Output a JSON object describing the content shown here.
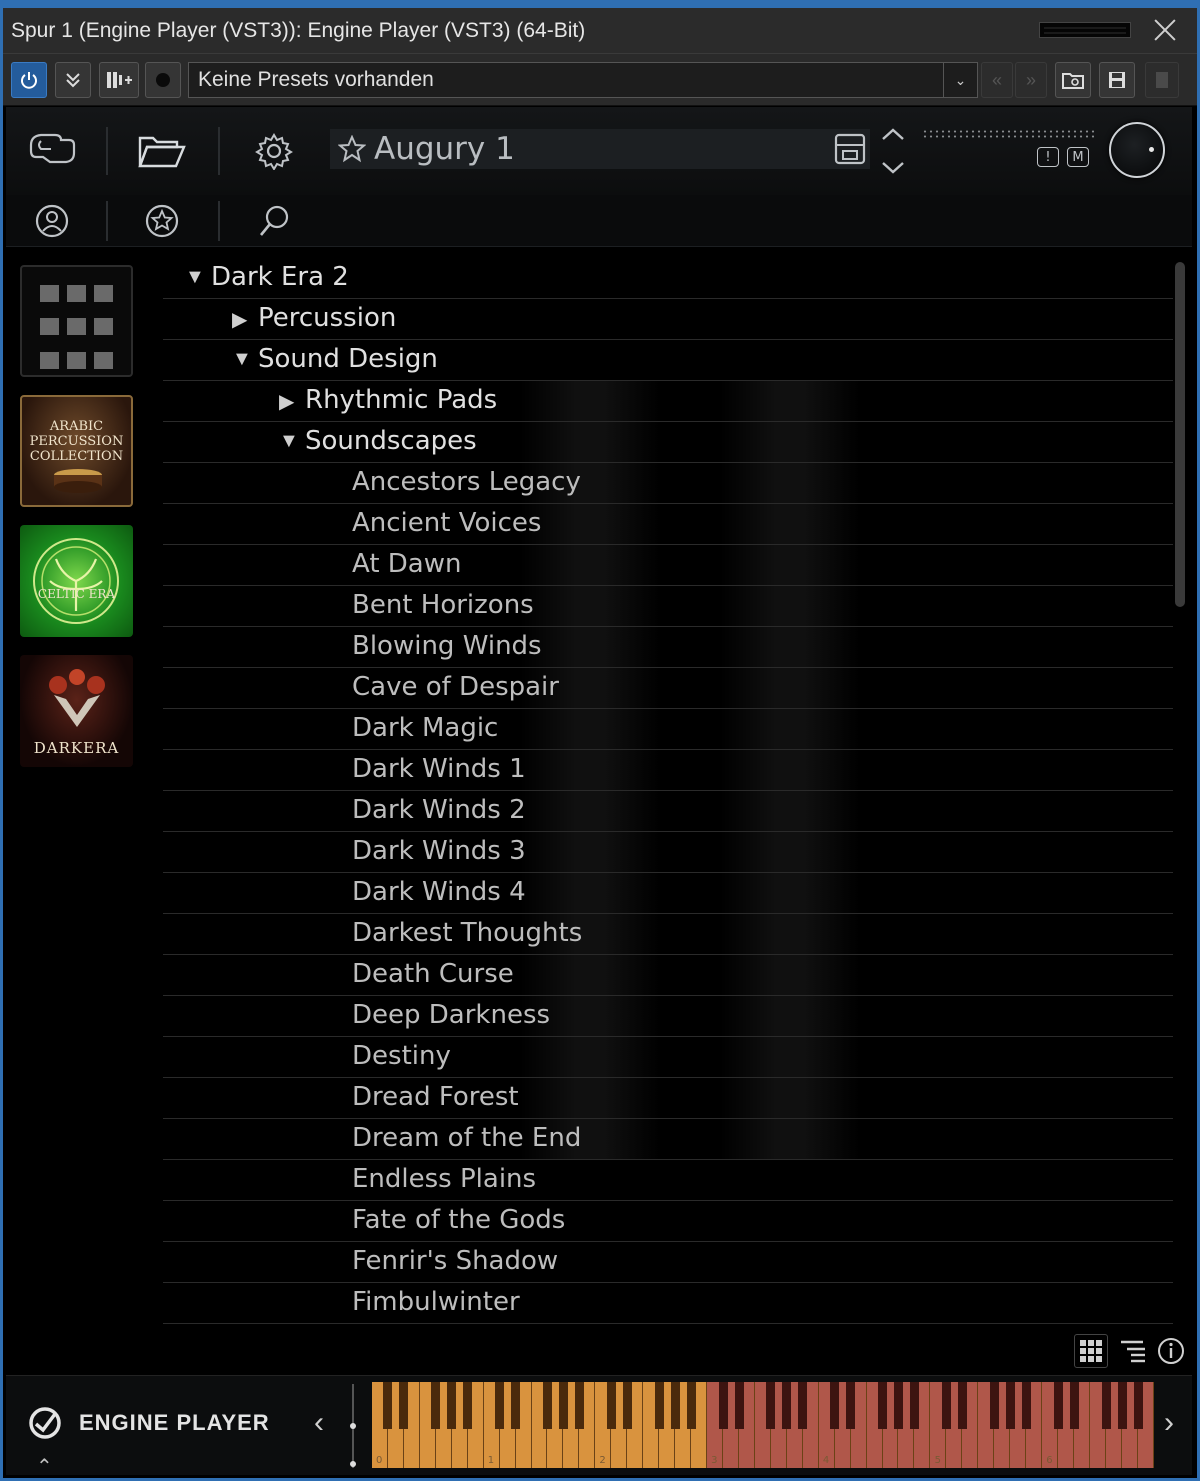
{
  "window": {
    "title": "Spur 1 (Engine Player (VST3)): Engine Player (VST3) (64-Bit)"
  },
  "host_toolbar": {
    "preset_text": "Keine Presets vorhanden"
  },
  "plugin": {
    "preset_name": "Augury 1",
    "instance_buttons": [
      "!",
      "M"
    ]
  },
  "library_tiles": [
    {
      "name": "grid-view",
      "label": ""
    },
    {
      "name": "arabic-percussion",
      "label": "ARABIC PERCUSSION COLLECTION"
    },
    {
      "name": "celtic-era",
      "label": "CELTIC ERA"
    },
    {
      "name": "dark-era",
      "label": "DARKERA"
    }
  ],
  "tree": [
    {
      "label": "Dark Era 2",
      "level": 0,
      "state": "expanded"
    },
    {
      "label": "Percussion",
      "level": 1,
      "state": "collapsed"
    },
    {
      "label": "Sound Design",
      "level": 1,
      "state": "expanded"
    },
    {
      "label": "Rhythmic Pads",
      "level": 2,
      "state": "collapsed"
    },
    {
      "label": "Soundscapes",
      "level": 2,
      "state": "expanded"
    },
    {
      "label": "Ancestors Legacy",
      "level": 3,
      "state": "leaf"
    },
    {
      "label": "Ancient Voices",
      "level": 3,
      "state": "leaf"
    },
    {
      "label": "At Dawn",
      "level": 3,
      "state": "leaf"
    },
    {
      "label": "Bent Horizons",
      "level": 3,
      "state": "leaf"
    },
    {
      "label": "Blowing Winds",
      "level": 3,
      "state": "leaf"
    },
    {
      "label": "Cave of Despair",
      "level": 3,
      "state": "leaf"
    },
    {
      "label": "Dark Magic",
      "level": 3,
      "state": "leaf"
    },
    {
      "label": "Dark Winds 1",
      "level": 3,
      "state": "leaf"
    },
    {
      "label": "Dark Winds 2",
      "level": 3,
      "state": "leaf"
    },
    {
      "label": "Dark Winds 3",
      "level": 3,
      "state": "leaf"
    },
    {
      "label": "Dark Winds 4",
      "level": 3,
      "state": "leaf"
    },
    {
      "label": "Darkest Thoughts",
      "level": 3,
      "state": "leaf"
    },
    {
      "label": "Death Curse",
      "level": 3,
      "state": "leaf"
    },
    {
      "label": "Deep Darkness",
      "level": 3,
      "state": "leaf"
    },
    {
      "label": "Destiny",
      "level": 3,
      "state": "leaf"
    },
    {
      "label": "Dread Forest",
      "level": 3,
      "state": "leaf"
    },
    {
      "label": "Dream of the End",
      "level": 3,
      "state": "leaf"
    },
    {
      "label": "Endless Plains",
      "level": 3,
      "state": "leaf"
    },
    {
      "label": "Fate of the Gods",
      "level": 3,
      "state": "leaf"
    },
    {
      "label": "Fenrir's Shadow",
      "level": 3,
      "state": "leaf"
    },
    {
      "label": "Fimbulwinter",
      "level": 3,
      "state": "leaf"
    }
  ],
  "footer": {
    "brand": "ENGINE PLAYER",
    "octave_labels": [
      "0",
      "1",
      "2",
      "3",
      "4",
      "5",
      "6"
    ]
  },
  "colors": {
    "window_border": "#2f6fb3",
    "keys_playable": "#d9933e",
    "keys_out_of_range": "#b0574a"
  }
}
